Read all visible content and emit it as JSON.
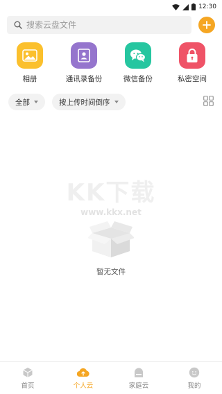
{
  "status": {
    "time": "12:30"
  },
  "search": {
    "placeholder": "搜索云盘文件"
  },
  "quick_actions": [
    {
      "label": "相册",
      "icon": "photo-album-icon",
      "color": "#fbc02d"
    },
    {
      "label": "通讯录备份",
      "icon": "contacts-backup-icon",
      "color": "#9575cd"
    },
    {
      "label": "微信备份",
      "icon": "wechat-icon",
      "color": "#26c6a0"
    },
    {
      "label": "私密空间",
      "icon": "lock-icon",
      "color": "#ef5367"
    }
  ],
  "filters": {
    "type_label": "全部",
    "sort_label": "按上传时间倒序"
  },
  "empty_state": {
    "text": "暂无文件"
  },
  "watermark": {
    "main": "KK下载",
    "sub": "www.kkx.net"
  },
  "tabs": [
    {
      "label": "首页",
      "icon": "home-cube-icon",
      "active": false
    },
    {
      "label": "个人云",
      "icon": "personal-cloud-icon",
      "active": true
    },
    {
      "label": "家庭云",
      "icon": "family-cloud-icon",
      "active": false
    },
    {
      "label": "我的",
      "icon": "profile-icon",
      "active": false
    }
  ],
  "colors": {
    "accent": "#f5a623",
    "chip_bg": "#f2f2f2",
    "inactive_tab": "#888888"
  }
}
